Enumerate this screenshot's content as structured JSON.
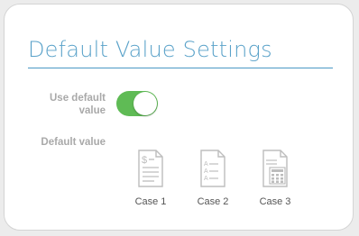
{
  "panel": {
    "title": "Default Value Settings",
    "accent_color": "#5aa2c9",
    "toggle_on_color": "#5fbb55"
  },
  "settings": {
    "use_default_label": "Use default value",
    "use_default_enabled": true,
    "default_value_label": "Default value"
  },
  "cases": [
    {
      "label": "Case 1",
      "icon": "dollar-document-icon"
    },
    {
      "label": "Case 2",
      "icon": "checklist-document-icon"
    },
    {
      "label": "Case 3",
      "icon": "calculator-document-icon"
    }
  ]
}
